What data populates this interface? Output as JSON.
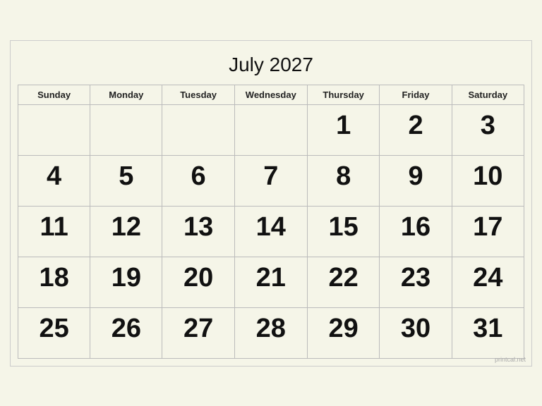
{
  "calendar": {
    "title": "July 2027",
    "days_of_week": [
      "Sunday",
      "Monday",
      "Tuesday",
      "Wednesday",
      "Thursday",
      "Friday",
      "Saturday"
    ],
    "weeks": [
      [
        "",
        "",
        "",
        "",
        "1",
        "2",
        "3"
      ],
      [
        "4",
        "5",
        "6",
        "7",
        "8",
        "9",
        "10"
      ],
      [
        "11",
        "12",
        "13",
        "14",
        "15",
        "16",
        "17"
      ],
      [
        "18",
        "19",
        "20",
        "21",
        "22",
        "23",
        "24"
      ],
      [
        "25",
        "26",
        "27",
        "28",
        "29",
        "30",
        "31"
      ]
    ],
    "watermark": "printcal.net"
  }
}
